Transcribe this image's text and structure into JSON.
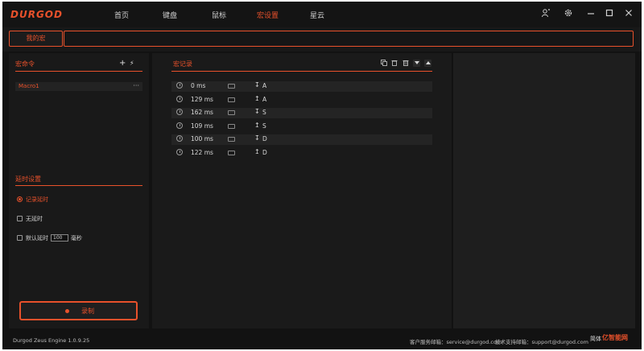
{
  "header": {
    "logo": "DURGOD",
    "nav": [
      "首页",
      "键盘",
      "鼠标",
      "宏设置",
      "星云"
    ],
    "active_nav": "宏设置",
    "icons": [
      "user-icon",
      "gear-icon",
      "minimize-icon",
      "maximize-icon",
      "close-icon"
    ]
  },
  "tabs": {
    "mine": "我的宏"
  },
  "macro_panel": {
    "title": "宏命令",
    "add_icon": "+",
    "flash_icon": "⚡",
    "items": [
      {
        "name": "Macro1",
        "more": "···"
      }
    ]
  },
  "delay": {
    "title": "延时设置",
    "options": [
      "记录延时",
      "无延时",
      "默认延时"
    ],
    "selected": "记录延时",
    "default_value": "100",
    "unit": "毫秒"
  },
  "record": {
    "label": "录制"
  },
  "record_panel": {
    "title": "宏记录",
    "tools": [
      "copy-icon",
      "trash-icon",
      "delete-icon",
      "move-down-icon",
      "move-up-icon"
    ],
    "rows": [
      {
        "time": "0 ms",
        "dir": "↧",
        "key": "A"
      },
      {
        "time": "129 ms",
        "dir": "↥",
        "key": "A"
      },
      {
        "time": "162 ms",
        "dir": "↧",
        "key": "S"
      },
      {
        "time": "109 ms",
        "dir": "↥",
        "key": "S"
      },
      {
        "time": "100 ms",
        "dir": "↧",
        "key": "D"
      },
      {
        "time": "122 ms",
        "dir": "↥",
        "key": "D"
      }
    ]
  },
  "footer": {
    "version": "Durgod Zeus Engine 1.0.9.25",
    "service": "客户服务邮箱：service@durgod.com",
    "support": "技术支持邮箱：support@durgod.com",
    "lang": "简体",
    "watermark": "亿智能网"
  },
  "colors": {
    "accent": "#e8512b",
    "background": "#121212",
    "panel": "#1a1a1a"
  }
}
